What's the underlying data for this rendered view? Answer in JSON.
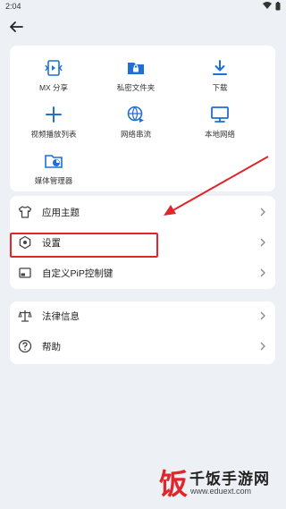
{
  "status_bar": {
    "time": "2:04"
  },
  "grid": [
    {
      "label": "MX 分享",
      "icon": "share-icon"
    },
    {
      "label": "私密文件夹",
      "icon": "private-folder-icon"
    },
    {
      "label": "下载",
      "icon": "download-icon"
    },
    {
      "label": "视频播放列表",
      "icon": "plus-icon"
    },
    {
      "label": "网络串流",
      "icon": "network-stream-icon"
    },
    {
      "label": "本地网络",
      "icon": "monitor-icon"
    },
    {
      "label": "媒体管理器",
      "icon": "media-manager-icon"
    }
  ],
  "menu1": [
    {
      "label": "应用主题",
      "icon": "shirt-icon"
    },
    {
      "label": "设置",
      "icon": "settings-icon"
    },
    {
      "label": "自定义PiP控制键",
      "icon": "pip-icon"
    }
  ],
  "menu2": [
    {
      "label": "法律信息",
      "icon": "scales-icon"
    },
    {
      "label": "帮助",
      "icon": "help-icon"
    }
  ],
  "watermark": {
    "title": "千饭手游网",
    "url": "www.eduext.com",
    "logo_text": "饭"
  },
  "colors": {
    "accent": "#1f6fd6",
    "annotation": "#e0262a"
  }
}
